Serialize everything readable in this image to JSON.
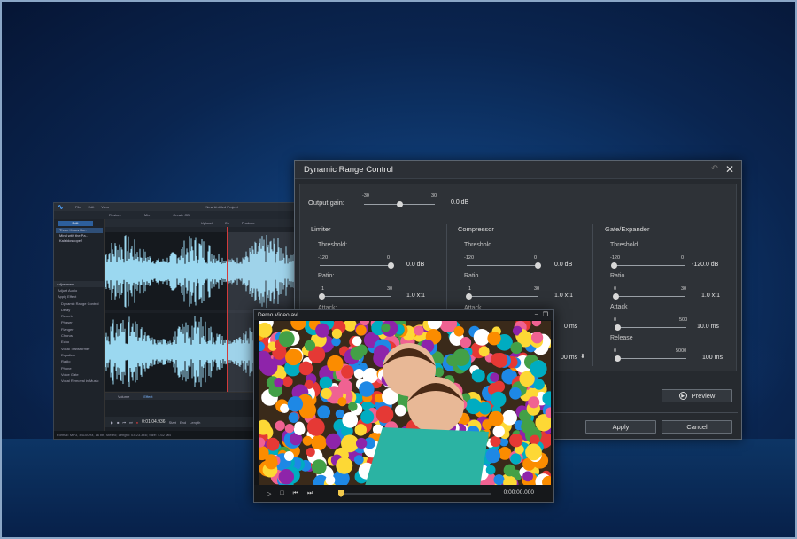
{
  "colors": {
    "accent": "#4fa3ff",
    "waveform": "#9bd8f0",
    "playhead": "#d23b3b",
    "background": "#0f3b73"
  },
  "editor": {
    "menu": [
      "File",
      "Edit",
      "View"
    ],
    "project_title": "*New Untitled Project",
    "left_button": "Edit",
    "files": [
      "Three Hours Ha..",
      "Mind with the Pa..",
      "Kaleidoscope2"
    ],
    "top_tabs": [
      "Restore",
      "Mix",
      "Create CD"
    ],
    "toolbar": [
      "Upload",
      "Co",
      "Produce"
    ],
    "adjust_header": "Adjustment",
    "adjust_items": [
      "Adjust Audio",
      "Apply Effect",
      "Dynamic Range Control",
      "Delay",
      "Reverb",
      "Phaser",
      "Flanger",
      "Chorus",
      "Echo",
      "Vocal Transformer",
      "Equalizer",
      "Radio",
      "Phone",
      "Voice Gate",
      "Vocal Removal in Music"
    ],
    "bottom_tabs": [
      "Volume",
      "Effect"
    ],
    "timecode": "0:01:04.936",
    "start_label": "Start",
    "end_label": "End",
    "length_label": "Length",
    "status": "Format: MP3, 44100Hz, 16 bit, Stereo; Length: 03:23.346; Size: 4.62 MB"
  },
  "drc": {
    "title": "Dynamic Range Control",
    "output_gain": {
      "label": "Output gain:",
      "min": "-30",
      "max": "30",
      "value": "0.0 dB",
      "level": 0.5
    },
    "limiter": {
      "title": "Limiter",
      "threshold": {
        "label": "Threshold:",
        "min": "-120",
        "max": "0",
        "value": "0.0 dB",
        "level": 1.0
      },
      "ratio": {
        "label": "Ratio:",
        "min": "1",
        "max": "30",
        "value": "1.0 x:1",
        "level": 0.0
      },
      "attack": {
        "label": "Attack:"
      }
    },
    "compressor": {
      "title": "Compressor",
      "threshold": {
        "label": "Threshold",
        "min": "-120",
        "max": "0",
        "value": "0.0 dB",
        "level": 1.0
      },
      "ratio": {
        "label": "Ratio",
        "min": "1",
        "max": "30",
        "value": "1.0 x:1",
        "level": 0.0
      },
      "attack": {
        "label": "Attack",
        "value": "0 ms"
      },
      "release_value": "00 ms"
    },
    "gate": {
      "title": "Gate/Expander",
      "threshold": {
        "label": "Threshold",
        "min": "-120",
        "max": "0",
        "value": "-120.0 dB",
        "level": 0.0
      },
      "ratio": {
        "label": "Ratio",
        "min": "0",
        "max": "30",
        "value": "1.0 x:1",
        "level": 0.0
      },
      "attack": {
        "label": "Attack",
        "min": "0",
        "max": "500",
        "value": "10.0 ms",
        "level": 0.02
      },
      "release": {
        "label": "Release",
        "min": "0",
        "max": "5000",
        "value": "100 ms",
        "level": 0.02
      }
    },
    "preview_label": "Preview",
    "apply_label": "Apply",
    "cancel_label": "Cancel"
  },
  "video": {
    "title": "Demo Video.avi",
    "timecode": "0:00:00.000",
    "progress": 0.0
  }
}
